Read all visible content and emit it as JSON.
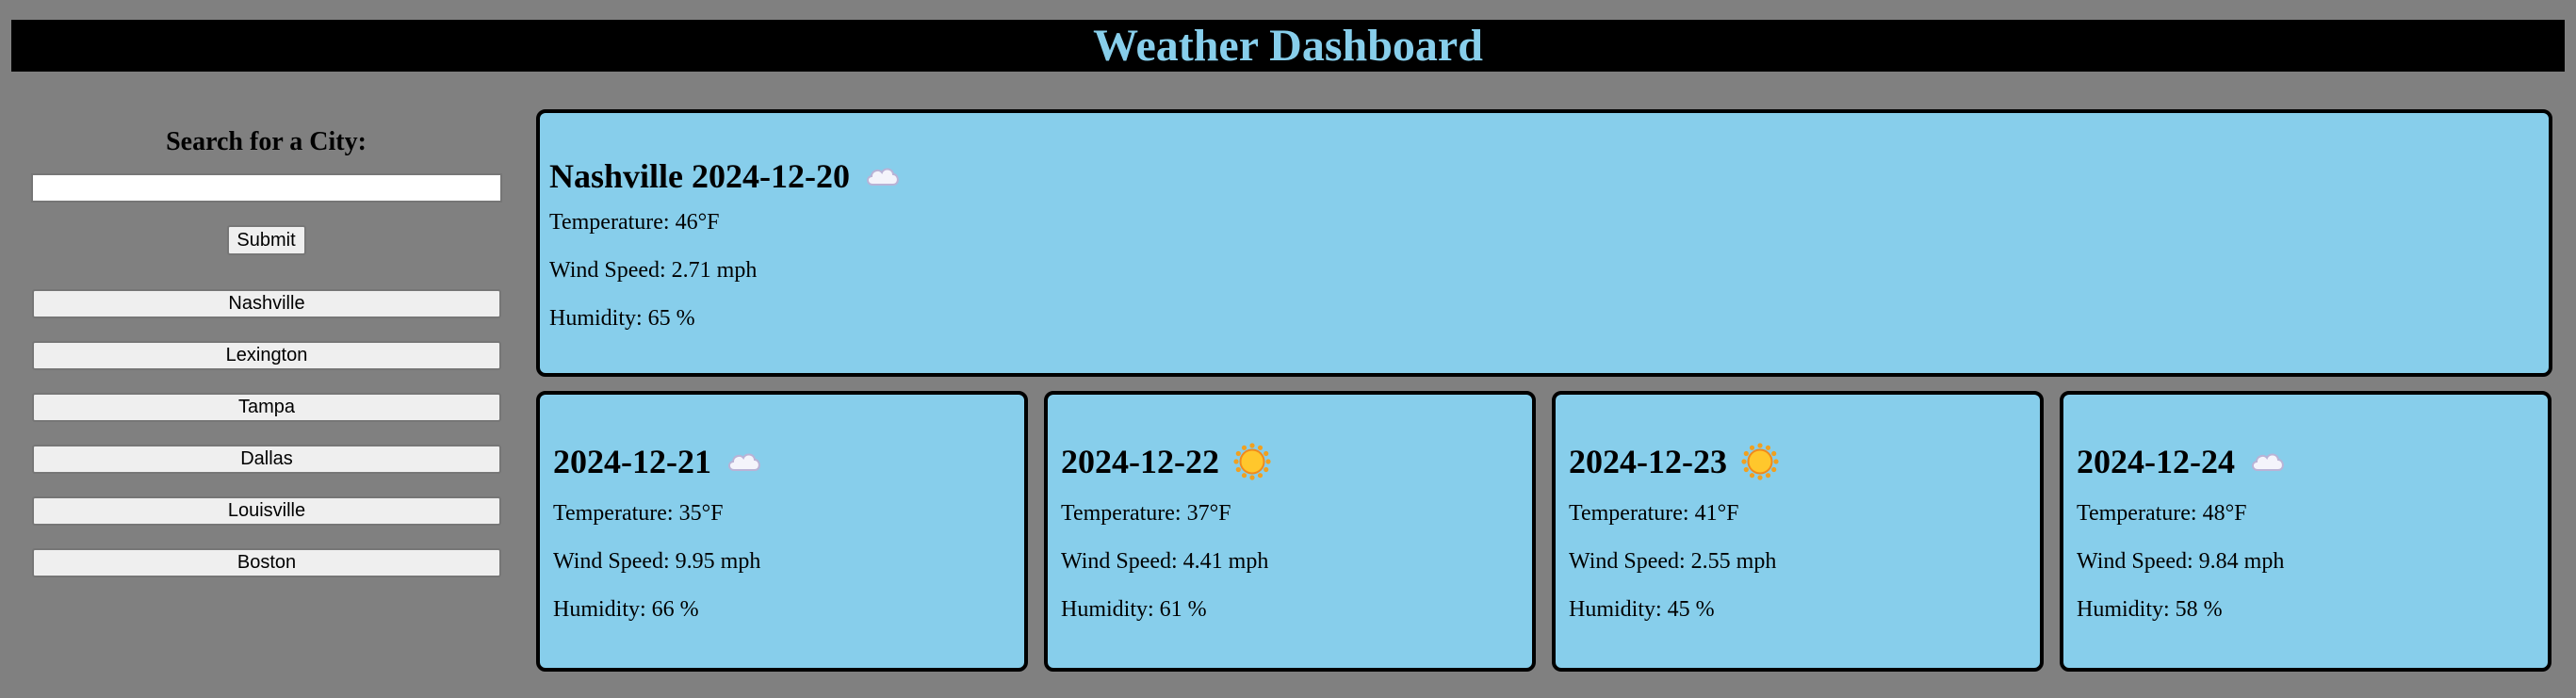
{
  "header": {
    "title": "Weather Dashboard"
  },
  "sidebar": {
    "title": "Search for a City:",
    "search_value": "",
    "submit_label": "Submit",
    "cities": [
      "Nashville",
      "Lexington",
      "Tampa",
      "Dallas",
      "Louisville",
      "Boston"
    ]
  },
  "labels": {
    "temperature": "Temperature:",
    "wind": "Wind Speed:",
    "humidity": "Humidity:"
  },
  "current": {
    "city": "Nashville",
    "date": "2024-12-20",
    "icon": "cloud-icon",
    "temperature": "Temperature: 46°F",
    "wind": "Wind Speed: 2.71 mph",
    "humidity": "Humidity: 65 %"
  },
  "forecast": [
    {
      "date": "2024-12-21",
      "icon": "cloud-icon",
      "temperature": "Temperature: 35°F",
      "wind": "Wind Speed: 9.95 mph",
      "humidity": "Humidity: 66 %"
    },
    {
      "date": "2024-12-22",
      "icon": "sun-icon",
      "temperature": "Temperature: 37°F",
      "wind": "Wind Speed: 4.41 mph",
      "humidity": "Humidity: 61 %"
    },
    {
      "date": "2024-12-23",
      "icon": "sun-icon",
      "temperature": "Temperature: 41°F",
      "wind": "Wind Speed: 2.55 mph",
      "humidity": "Humidity: 45 %"
    },
    {
      "date": "2024-12-24",
      "icon": "cloud-icon",
      "temperature": "Temperature: 48°F",
      "wind": "Wind Speed: 9.84 mph",
      "humidity": "Humidity: 58 %"
    }
  ],
  "colors": {
    "background": "#808080",
    "header_bg": "#000000",
    "accent": "#87ceeb",
    "card_border": "#000000"
  }
}
